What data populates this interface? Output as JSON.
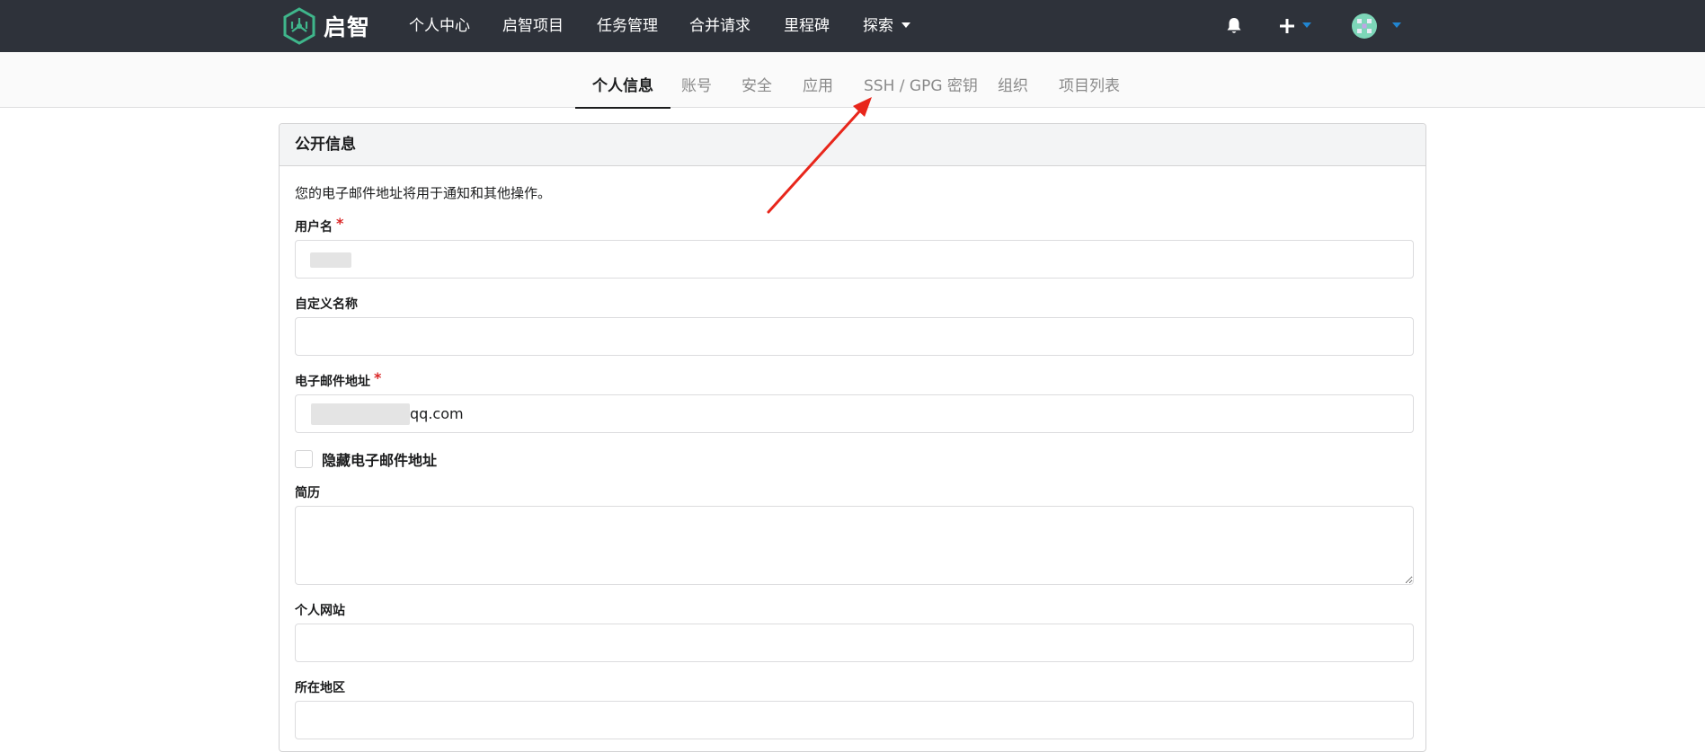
{
  "header": {
    "brand": "启智",
    "nav": [
      "个人中心",
      "启智项目",
      "任务管理",
      "合并请求",
      "里程碑",
      "探索"
    ],
    "bell_icon": "bell-icon",
    "plus_icon": "plus-icon",
    "avatar_icon": "avatar-icon"
  },
  "tabs": {
    "items": [
      "个人信息",
      "账号",
      "安全",
      "应用",
      "SSH / GPG 密钥",
      "组织",
      "项目列表"
    ],
    "active": "个人信息"
  },
  "panel": {
    "title": "公开信息",
    "help": "您的电子邮件地址将用于通知和其他操作。",
    "username": {
      "label": "用户名",
      "required_mark": "*",
      "value": ""
    },
    "full_name": {
      "label": "自定义名称",
      "value": ""
    },
    "email": {
      "label": "电子邮件地址",
      "required_mark": "*",
      "value_suffix": "qq.com"
    },
    "hide_email": {
      "label": "隐藏电子邮件地址",
      "checked": false
    },
    "bio": {
      "label": "简历",
      "value": ""
    },
    "website": {
      "label": "个人网站",
      "value": ""
    },
    "location": {
      "label": "所在地区",
      "value": ""
    }
  },
  "colors": {
    "navbar": "#2e323a",
    "accent_blue": "#2185d0",
    "required_red": "#db2828",
    "annotation_arrow": "#e8261b"
  }
}
